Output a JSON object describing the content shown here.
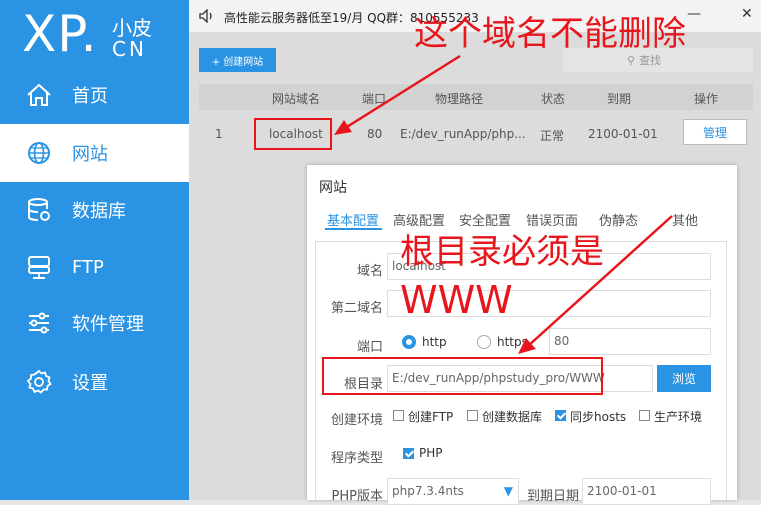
{
  "logo": {
    "xp": "XP.",
    "cn_top": "小皮",
    "cn_bottom": "CN"
  },
  "nav": [
    {
      "label": "首页",
      "icon": "home-icon"
    },
    {
      "label": "网站",
      "icon": "globe-icon"
    },
    {
      "label": "数据库",
      "icon": "database-icon"
    },
    {
      "label": "FTP",
      "icon": "server-icon"
    },
    {
      "label": "软件管理",
      "icon": "sliders-icon"
    },
    {
      "label": "设置",
      "icon": "gear-icon"
    }
  ],
  "topbar": {
    "ad": "高性能云服务器低至19/月  QQ群：810555233",
    "minimize": "—",
    "close": "✕"
  },
  "toolbar": {
    "create_label": "+ 创建网站",
    "search_placeholder": "查找"
  },
  "table": {
    "headers": [
      "网站域名",
      "端口",
      "物理路径",
      "状态",
      "到期",
      "操作"
    ],
    "rows": [
      {
        "index": "1",
        "domain": "localhost",
        "port": "80",
        "path": "E:/dev_runApp/php...",
        "status": "正常",
        "expire": "2100-01-01",
        "action": "管理"
      }
    ]
  },
  "dialog": {
    "title": "网站",
    "tabs": [
      "基本配置",
      "高级配置",
      "安全配置",
      "错误页面",
      "伪静态",
      "其他"
    ],
    "fields": {
      "domain_label": "域名",
      "domain_value": "localhost",
      "second_domain_label": "第二域名",
      "second_domain_value": "",
      "port_label": "端口",
      "protocol_http": "http",
      "protocol_https": "https",
      "port_value": "80",
      "root_label": "根目录",
      "root_value": "E:/dev_runApp/phpstudy_pro/WWW",
      "browse_label": "浏览",
      "env_label": "创建环境",
      "env_options": [
        "创建FTP",
        "创建数据库",
        "同步hosts",
        "生产环境"
      ],
      "type_label": "程序类型",
      "type_option": "PHP",
      "php_label": "PHP版本",
      "php_value": "php7.3.4nts",
      "expire_label": "到期日期",
      "expire_value": "2100-01-01"
    }
  },
  "annotations": {
    "top": "这个域名不能删除",
    "middle_line1": "根目录必须是",
    "middle_line2": "WWW"
  },
  "colors": {
    "accent": "#2b93e3",
    "annotation": "#e8161c"
  }
}
